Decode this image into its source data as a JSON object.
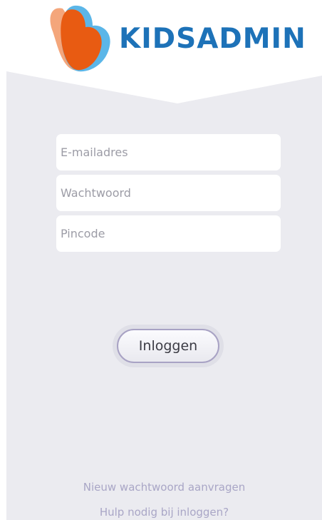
{
  "brand": {
    "name": "KIDSADMIN",
    "colors": {
      "text": "#1d72b8",
      "orange": "#e85b12",
      "peach": "#f4a67b",
      "blue": "#5bb6e8"
    }
  },
  "form": {
    "email_placeholder": "E-mailadres",
    "password_placeholder": "Wachtwoord",
    "pincode_placeholder": "Pincode",
    "login_label": "Inloggen"
  },
  "links": {
    "reset_password": "Nieuw wachtwoord aanvragen",
    "help": "Hulp nodig bij inloggen?"
  },
  "colors": {
    "panel": "#ebebf0",
    "link": "#a9a6c6",
    "button_border": "#a8a2c4"
  }
}
